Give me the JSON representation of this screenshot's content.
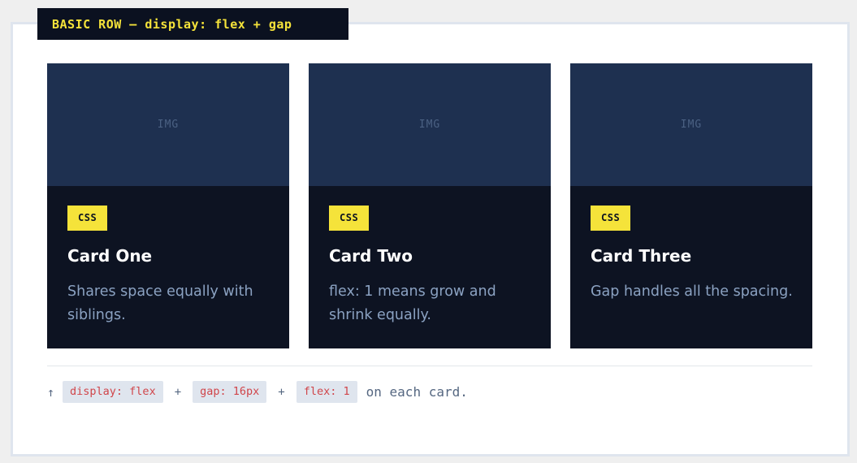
{
  "section": {
    "label": "BASIC ROW — display: flex + gap"
  },
  "cards": [
    {
      "image_placeholder": "IMG",
      "badge": "CSS",
      "title": "Card One",
      "description": "Shares space equally with siblings."
    },
    {
      "image_placeholder": "IMG",
      "badge": "CSS",
      "title": "Card Two",
      "description": "flex: 1 means grow and shrink equally."
    },
    {
      "image_placeholder": "IMG",
      "badge": "CSS",
      "title": "Card Three",
      "description": "Gap handles all the spacing."
    }
  ],
  "footnote": {
    "arrow": "↑",
    "code_1": "display: flex",
    "plus_1": "+",
    "code_2": "gap: 16px",
    "plus_2": "+",
    "code_3": "flex: 1",
    "tail": "on each card."
  },
  "colors": {
    "accent_yellow": "#f5e33a",
    "card_background": "#0d1322",
    "image_background": "#1e3050",
    "code_text": "#d0454a"
  }
}
